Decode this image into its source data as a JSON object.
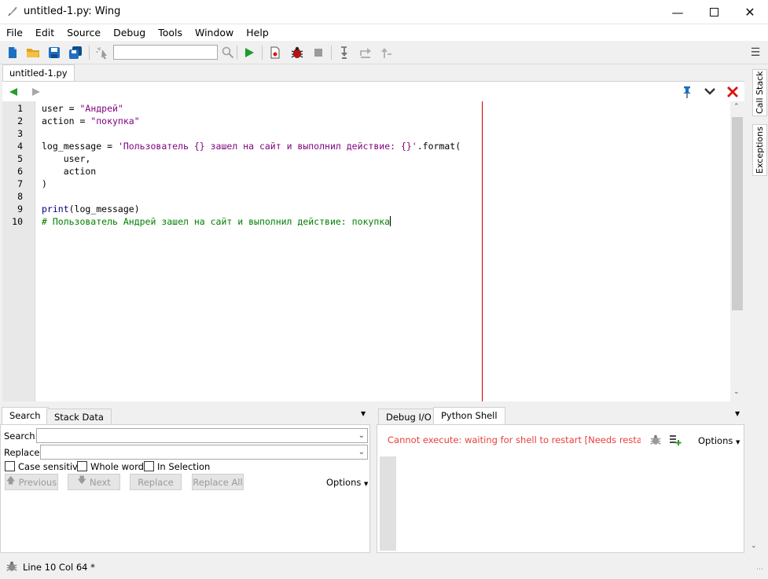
{
  "window": {
    "title": "untitled-1.py: Wing"
  },
  "menu": [
    "File",
    "Edit",
    "Source",
    "Debug",
    "Tools",
    "Window",
    "Help"
  ],
  "toolbar": {
    "search_value": ""
  },
  "tabs": {
    "file": "untitled-1.py"
  },
  "editor": {
    "line_numbers": [
      "1",
      "2",
      "3",
      "4",
      "5",
      "6",
      "7",
      "8",
      "9",
      "10"
    ],
    "lines": {
      "l1a": "user = ",
      "l1b": "\"Андрей\"",
      "l2a": "action = ",
      "l2b": "\"покупка\"",
      "l4a": "log_message = ",
      "l4b": "'Пользователь {} зашел на сайт и выполнил действие: {}'",
      "l4c": ".format(",
      "l5": "    user,",
      "l6": "    action",
      "l7": ")",
      "l9a": "print",
      "l9b": "(log_message)",
      "l10": "# Пользователь Андрей зашел на сайт и выполнил действие: покупка"
    }
  },
  "side_tabs": {
    "call_stack": "Call Stack",
    "exceptions": "Exceptions"
  },
  "search_panel": {
    "tab_search": "Search",
    "tab_stack": "Stack Data",
    "search_label": "Search:",
    "replace_label": "Replace:",
    "search_value": "",
    "replace_value": "",
    "case_sensitive": "Case sensitive",
    "whole_words": "Whole words",
    "in_selection": "In Selection",
    "previous": "Previous",
    "next": "Next",
    "replace": "Replace",
    "replace_all": "Replace All",
    "options": "Options"
  },
  "shell_panel": {
    "tab_debug_io": "Debug I/O",
    "tab_python_shell": "Python Shell",
    "message": "Cannot execute: waiting for shell to restart [Needs restart for Pyth",
    "options": "Options"
  },
  "status": {
    "text": "Line 10 Col 64 *"
  },
  "colors": {
    "keyword": "#00007f",
    "string": "#7f007f",
    "comment": "#007f00",
    "error": "#e8413c",
    "edge_line": "#cc0000"
  }
}
